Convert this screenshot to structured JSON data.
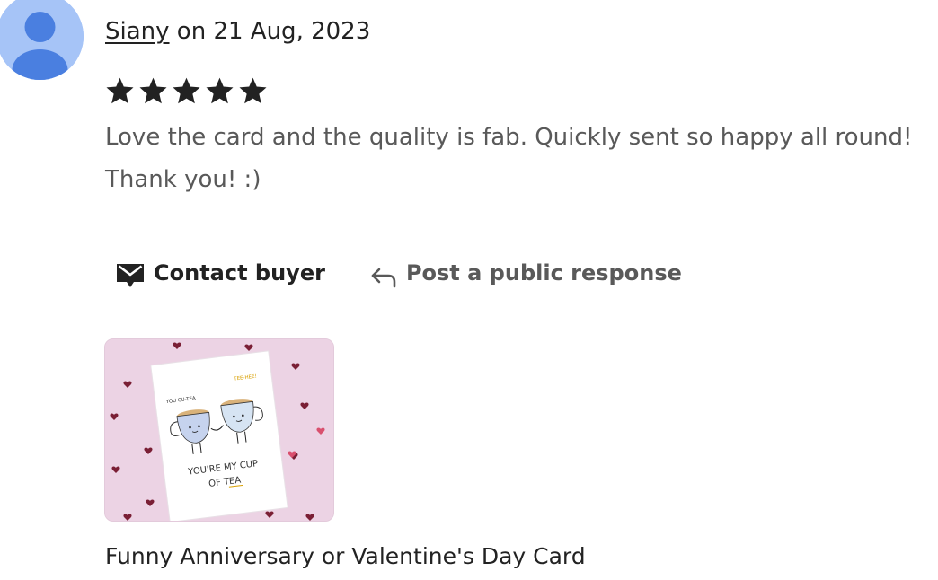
{
  "review": {
    "user_name": "Siany",
    "date_text": " on 21 Aug, 2023",
    "rating": 5,
    "rating_max": 5,
    "star_color": "#222222",
    "text": "Love the card and the quality is fab. Quickly sent so happy all round! Thank you! :)"
  },
  "actions": {
    "contact_label": "Contact buyer",
    "contact_icon": "envelope-icon",
    "respond_label": "Post a public response",
    "respond_icon": "reply-arrow-icon"
  },
  "product": {
    "title": "Funny Anniversary or Valentine's Day Card",
    "image_text": {
      "left_bubble": "YOU CU-TEA",
      "right_bubble": "TEE-HEE!",
      "line1": "YOU'RE MY CUP",
      "line2": "OF TEA"
    }
  },
  "colors": {
    "avatar_bg": "#a6c4f7",
    "avatar_fg": "#4a7fe0",
    "text_muted": "#595959",
    "text_main": "#222222",
    "thumb_bg": "#ecd3e4"
  }
}
